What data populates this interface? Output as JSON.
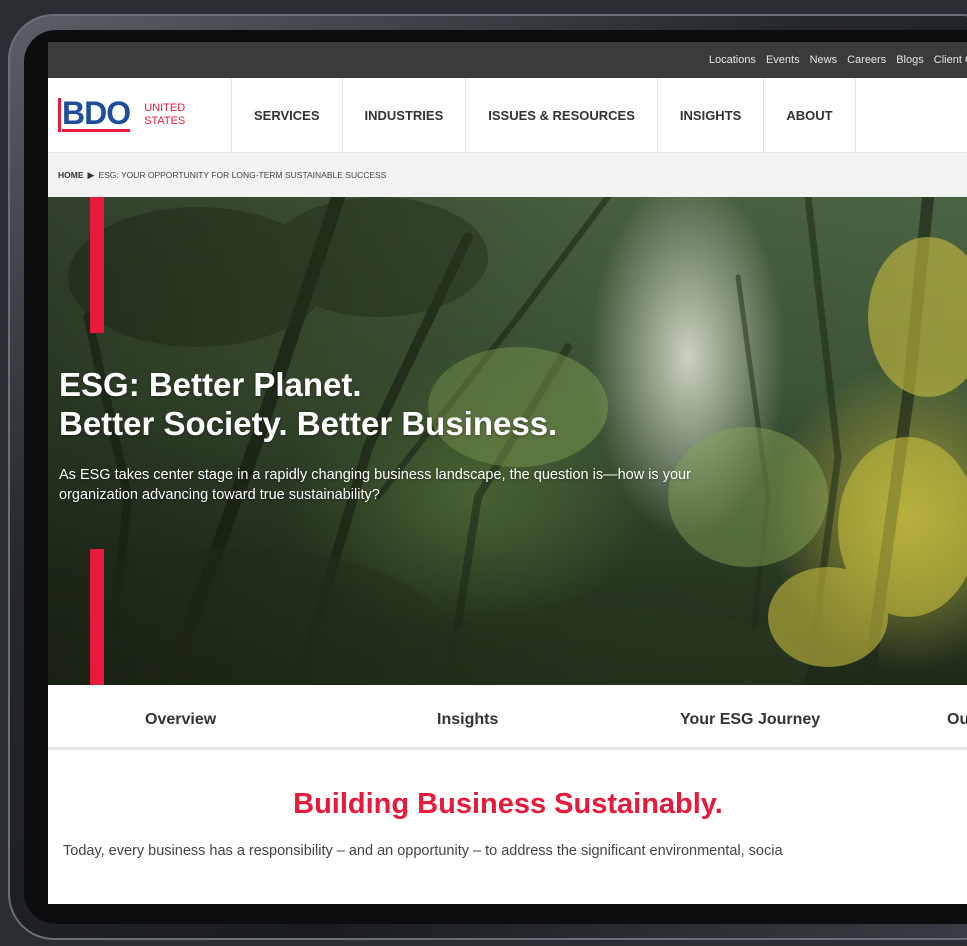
{
  "utility_nav": [
    "Locations",
    "Events",
    "News",
    "Careers",
    "Blogs",
    "Client Co"
  ],
  "logo": {
    "name": "BDO",
    "sub_line1": "UNITED",
    "sub_line2": "STATES"
  },
  "main_nav": [
    "SERVICES",
    "INDUSTRIES",
    "ISSUES & RESOURCES",
    "INSIGHTS",
    "ABOUT"
  ],
  "breadcrumb": {
    "home": "HOME",
    "separator": "▶",
    "current": "ESG: YOUR OPPORTUNITY FOR LONG-TERM SUSTAINABLE SUCCESS"
  },
  "hero": {
    "title_line1": "ESG: Better Planet.",
    "title_line2": "Better Society. Better Business.",
    "subtitle": "As ESG takes center stage in a rapidly changing business landscape, the question is—how is your organization advancing toward true sustainability?"
  },
  "page_tabs": [
    "Overview",
    "Insights",
    "Your ESG Journey",
    "Ou"
  ],
  "content": {
    "heading": "Building Business Sustainably.",
    "text": "Today, every business has a responsibility – and an opportunity – to address the significant environmental, socia"
  },
  "colors": {
    "brand_red": "#e81a3b",
    "brand_blue": "#1d4d9c",
    "utility_bar": "#3a3b3d"
  }
}
